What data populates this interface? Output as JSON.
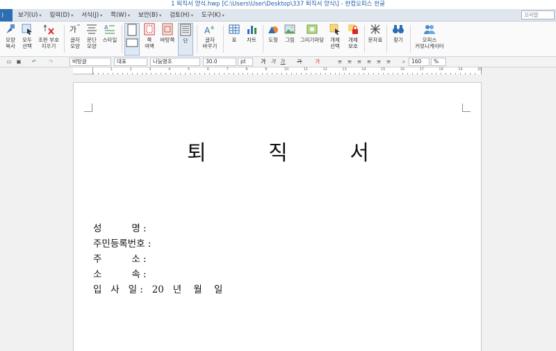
{
  "titlebar": {
    "title": "1 퇴직서 양식.hwp [C:\\Users\\User\\Desktop\\337 퇴직서 양식\\] - 한컴오피스 한글"
  },
  "menu": {
    "file_label": ")",
    "items": [
      "보기(U)",
      "입력(D)",
      "서식(J)",
      "쪽(W)",
      "보안(B)",
      "검토(H)",
      "도구(K)"
    ],
    "help_placeholder": "꼬리말"
  },
  "ribbon": {
    "shape_copy": [
      "모양",
      "복사"
    ],
    "select_all": [
      "모두",
      "선택"
    ],
    "combine_symbols": [
      "조판 부호",
      "지우기"
    ],
    "char_shape": [
      "글자",
      "모양"
    ],
    "para_shape": [
      "문단",
      "모양"
    ],
    "style": [
      "스타일"
    ],
    "margin": [
      "쪽",
      "여백"
    ],
    "bg_page": [
      "바탕쪽"
    ],
    "columns": [
      "단"
    ],
    "change_char": [
      "글자",
      "바꾸기"
    ],
    "table": [
      "표"
    ],
    "chart": [
      "차트"
    ],
    "shape": [
      "도형"
    ],
    "picture": [
      "그림"
    ],
    "draw_magic": [
      "그리기마당"
    ],
    "object_select": [
      "개체",
      "선택"
    ],
    "object_protect": [
      "개체",
      "보호"
    ],
    "char_table": [
      "문자표"
    ],
    "find": [
      "찾기"
    ],
    "communicator": [
      "오피스",
      "커뮤니케이터"
    ]
  },
  "format": {
    "style_name": "바탕글",
    "font_lang": "대표",
    "font_name": "나눔명조",
    "font_size": "30.0",
    "unit": "pt",
    "bold": "가",
    "italic": "가",
    "underline": "가",
    "strike": "가",
    "color": "가",
    "zoom": "160",
    "zoom_unit": "%"
  },
  "ruler": {
    "numbers": [
      "1",
      "2",
      "3",
      "4",
      "5",
      "6",
      "7",
      "8",
      "9",
      "10",
      "11",
      "12",
      "13",
      "14",
      "15",
      "16",
      "17",
      "18",
      "19",
      "20"
    ]
  },
  "document": {
    "title": "퇴  직  서",
    "fields": [
      "성          명 :",
      "주민등록번호 :",
      "주          소 :",
      "소          속 :",
      "입   사   일 :   20   년    월    일"
    ]
  },
  "colors": {
    "accent": "#2c6db4",
    "title_text": "#1f5fa8",
    "page_bg": "#ffffff",
    "workspace_bg": "#f1f1f1"
  }
}
